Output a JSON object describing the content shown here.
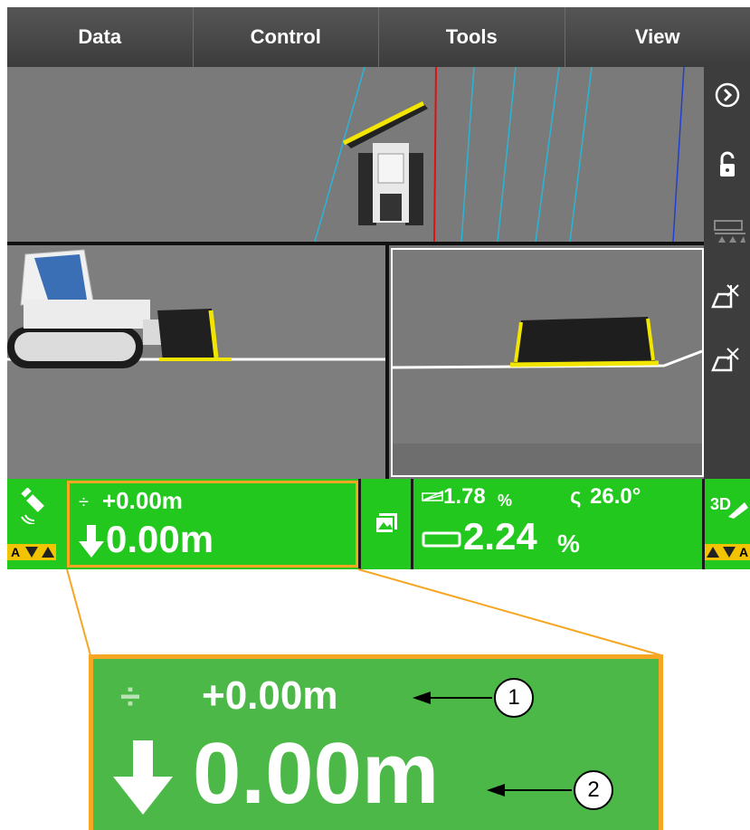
{
  "menu": {
    "items": [
      {
        "label": "Data"
      },
      {
        "label": "Control"
      },
      {
        "label": "Tools"
      },
      {
        "label": "View"
      }
    ]
  },
  "toolbar": {
    "buttons": [
      {
        "icon": "chevron-right-icon"
      },
      {
        "icon": "lock-open-icon"
      },
      {
        "icon": "blade-sensors-icon"
      },
      {
        "icon": "design-surface-1-icon"
      },
      {
        "icon": "design-surface-2-icon"
      }
    ]
  },
  "status": {
    "gnss_indicator": {
      "letter": "A"
    },
    "elevation": {
      "offset": "+0.00m",
      "cut_fill": "0.00m"
    },
    "gallery_icon": "gallery-icon",
    "slope": {
      "cross_slope_small": "1.78",
      "cross_slope_small_unit": "%",
      "angle": "26.0°",
      "main_slope": "2.24",
      "main_slope_unit": "%"
    },
    "mode": {
      "label": "3D",
      "letter": "A"
    }
  },
  "callout": {
    "offset": "+0.00m",
    "cut_fill": "0.00m",
    "markers": [
      "1",
      "2"
    ]
  },
  "colors": {
    "status_green": "#22c81e",
    "callout_green": "#4cb848",
    "highlight_orange": "#f5a623",
    "blade_yellow": "#f2e600"
  }
}
